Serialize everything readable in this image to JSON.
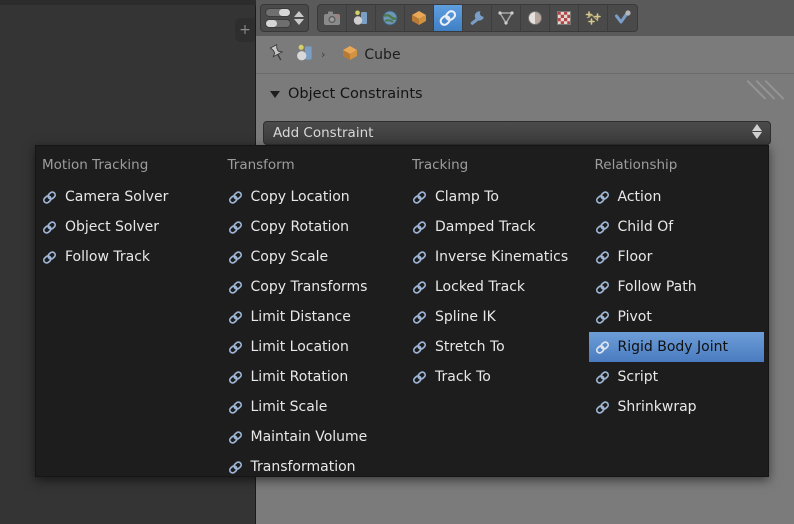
{
  "app": "blender-properties-editor",
  "viewport": {
    "name": "3d-viewport",
    "plus_tab_label": "+"
  },
  "properties_editor": {
    "header": {
      "editor_type_selector": "editor-type-selector",
      "tabs": [
        {
          "name": "render-tab",
          "icon": "camera-icon",
          "active": false
        },
        {
          "name": "scene-tab",
          "icon": "scene-icon",
          "active": false
        },
        {
          "name": "world-tab",
          "icon": "world-globe-icon",
          "active": false
        },
        {
          "name": "object-tab",
          "icon": "cube-icon",
          "active": false
        },
        {
          "name": "constraints-tab",
          "icon": "chain-link-icon",
          "active": true
        },
        {
          "name": "modifiers-tab",
          "icon": "wrench-icon",
          "active": false
        },
        {
          "name": "data-tab",
          "icon": "mesh-triangle-icon",
          "active": false
        },
        {
          "name": "material-tab",
          "icon": "material-sphere-icon",
          "active": false
        },
        {
          "name": "texture-tab",
          "icon": "checker-texture-icon",
          "active": false
        },
        {
          "name": "particles-tab",
          "icon": "particles-icon",
          "active": false
        },
        {
          "name": "physics-tab",
          "icon": "physics-icon",
          "active": false
        }
      ]
    },
    "breadcrumb": {
      "pin_icon": "pin-icon",
      "scene_icon": "scene-icon",
      "separator": "›",
      "object_icon": "cube-icon",
      "object_name": "Cube"
    },
    "panel": {
      "title": "Object Constraints",
      "collapse_icon": "triangle-down-icon",
      "grip_icon": "resize-grip-icon"
    },
    "add_constraint": {
      "label": "Add Constraint",
      "spinner_up_icon": "triangle-up-icon",
      "spinner_down_icon": "triangle-down-icon"
    }
  },
  "constraint_menu": {
    "name": "add-constraint-menu",
    "item_icon": "chain-link-icon",
    "selected_item": "Rigid Body Joint",
    "columns": [
      {
        "heading": "Motion Tracking",
        "items": [
          "Camera Solver",
          "Object Solver",
          "Follow Track"
        ]
      },
      {
        "heading": "Transform",
        "items": [
          "Copy Location",
          "Copy Rotation",
          "Copy Scale",
          "Copy Transforms",
          "Limit Distance",
          "Limit Location",
          "Limit Rotation",
          "Limit Scale",
          "Maintain Volume",
          "Transformation"
        ]
      },
      {
        "heading": "Tracking",
        "items": [
          "Clamp To",
          "Damped Track",
          "Inverse Kinematics",
          "Locked Track",
          "Spline IK",
          "Stretch To",
          "Track To"
        ]
      },
      {
        "heading": "Relationship",
        "items": [
          "Action",
          "Child Of",
          "Floor",
          "Follow Path",
          "Pivot",
          "Rigid Body Joint",
          "Script",
          "Shrinkwrap"
        ]
      }
    ]
  },
  "colors": {
    "menu_background": "#1d1d1d",
    "highlight_blue": "#5a8ecb",
    "panel_background": "#7b7b7b",
    "header_background": "#5a5a5a",
    "viewport_background": "#343434",
    "chain_icon": "#9fb6d6"
  }
}
